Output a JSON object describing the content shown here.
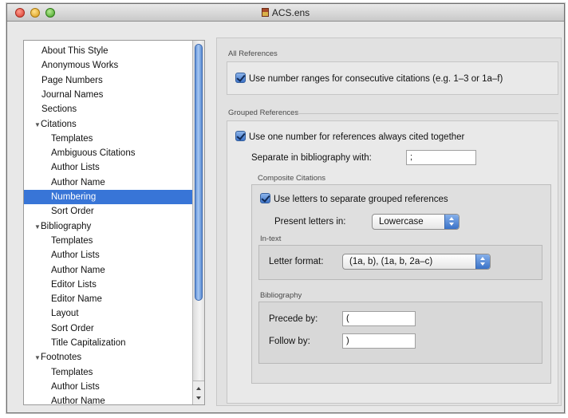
{
  "window": {
    "title": "ACS.ens"
  },
  "sidebar": {
    "items": [
      {
        "label": "About This Style",
        "indent": 0,
        "disclosure": ""
      },
      {
        "label": "Anonymous Works",
        "indent": 0,
        "disclosure": ""
      },
      {
        "label": "Page Numbers",
        "indent": 0,
        "disclosure": ""
      },
      {
        "label": "Journal Names",
        "indent": 0,
        "disclosure": ""
      },
      {
        "label": "Sections",
        "indent": 0,
        "disclosure": ""
      },
      {
        "label": "Citations",
        "indent": 0,
        "disclosure": "▼"
      },
      {
        "label": "Templates",
        "indent": 1,
        "disclosure": ""
      },
      {
        "label": "Ambiguous Citations",
        "indent": 1,
        "disclosure": ""
      },
      {
        "label": "Author Lists",
        "indent": 1,
        "disclosure": ""
      },
      {
        "label": "Author Name",
        "indent": 1,
        "disclosure": ""
      },
      {
        "label": "Numbering",
        "indent": 1,
        "disclosure": "",
        "selected": true
      },
      {
        "label": "Sort Order",
        "indent": 1,
        "disclosure": ""
      },
      {
        "label": "Bibliography",
        "indent": 0,
        "disclosure": "▼"
      },
      {
        "label": "Templates",
        "indent": 1,
        "disclosure": ""
      },
      {
        "label": "Author Lists",
        "indent": 1,
        "disclosure": ""
      },
      {
        "label": "Author Name",
        "indent": 1,
        "disclosure": ""
      },
      {
        "label": "Editor Lists",
        "indent": 1,
        "disclosure": ""
      },
      {
        "label": "Editor Name",
        "indent": 1,
        "disclosure": ""
      },
      {
        "label": "Layout",
        "indent": 1,
        "disclosure": ""
      },
      {
        "label": "Sort Order",
        "indent": 1,
        "disclosure": ""
      },
      {
        "label": "Title Capitalization",
        "indent": 1,
        "disclosure": ""
      },
      {
        "label": "Footnotes",
        "indent": 0,
        "disclosure": "▼"
      },
      {
        "label": "Templates",
        "indent": 1,
        "disclosure": ""
      },
      {
        "label": "Author Lists",
        "indent": 1,
        "disclosure": ""
      },
      {
        "label": "Author Name",
        "indent": 1,
        "disclosure": ""
      }
    ]
  },
  "all_references": {
    "title": "All References",
    "use_number_ranges": {
      "label": "Use number ranges for consecutive citations (e.g. 1–3 or 1a–f)",
      "checked": true
    }
  },
  "grouped_references": {
    "title": "Grouped References",
    "use_one_number": {
      "label": "Use one number for references always cited together",
      "checked": true
    },
    "separate_label": "Separate in bibliography with:",
    "separate_value": ";",
    "composite": {
      "title": "Composite Citations",
      "use_letters": {
        "label": "Use letters to separate grouped references",
        "checked": true
      },
      "present_letters_label": "Present letters in:",
      "present_letters_value": "Lowercase",
      "in_text": {
        "title": "In-text",
        "letter_format_label": "Letter format:",
        "letter_format_value": "(1a, b), (1a, b, 2a–c)"
      },
      "bibliography": {
        "title": "Bibliography",
        "precede_label": "Precede by:",
        "precede_value": "(",
        "follow_label": "Follow by:",
        "follow_value": ")"
      }
    }
  }
}
